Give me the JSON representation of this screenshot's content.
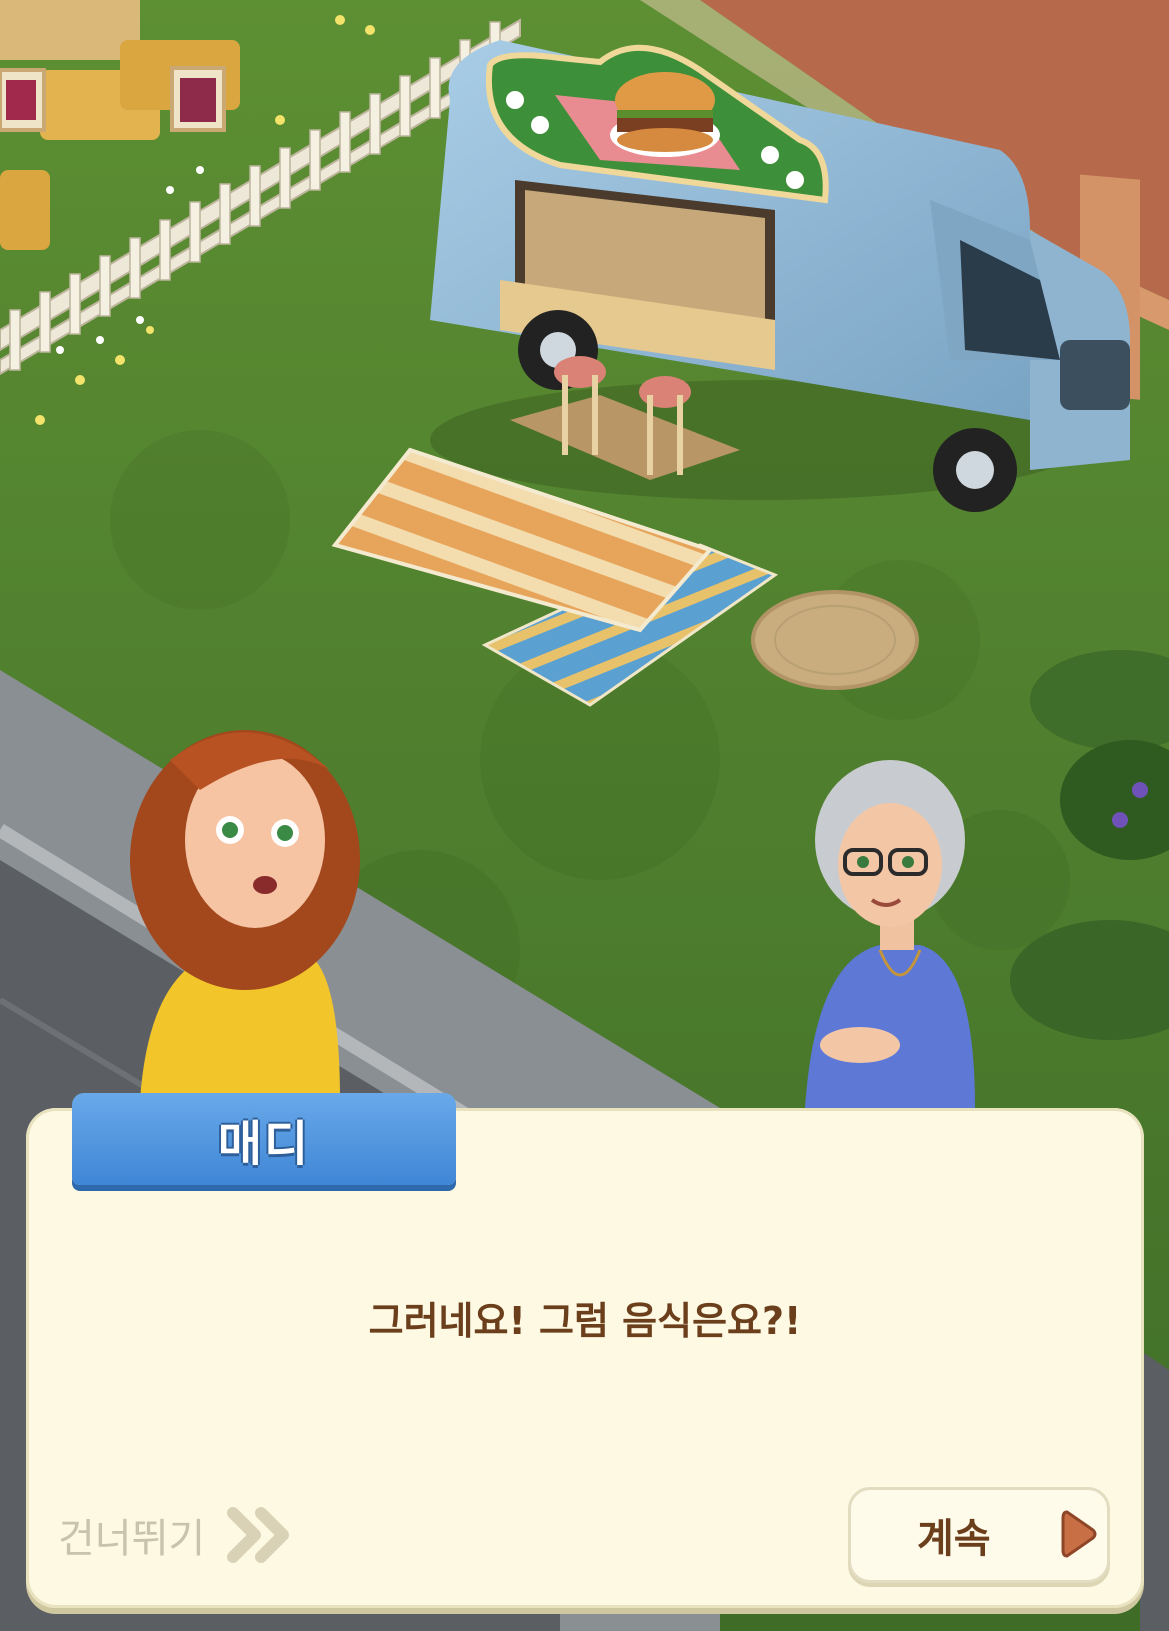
{
  "dialog": {
    "speaker_name": "매디",
    "message": "그러네요! 그럼 음식은요?!"
  },
  "controls": {
    "skip_label": "건너뛰기",
    "skip_icon": "double-chevron-right-icon",
    "continue_label": "계속",
    "continue_icon": "play-triangle-icon"
  },
  "scene": {
    "characters": [
      "madi",
      "grandmother"
    ],
    "objects": [
      "food-truck",
      "burger-sign",
      "bar-stools",
      "striped-rugs",
      "round-mat",
      "picket-fence",
      "hay-bales",
      "brick-wall",
      "sidewalk",
      "road"
    ]
  },
  "colors": {
    "name_tab": "#4b90dc",
    "dialog_bg": "#fdf9e3",
    "dialog_text": "#6b3f1c",
    "skip_text": "#c9c3ad",
    "grass": "#5a8a32",
    "truck": "#8fb8d6"
  }
}
